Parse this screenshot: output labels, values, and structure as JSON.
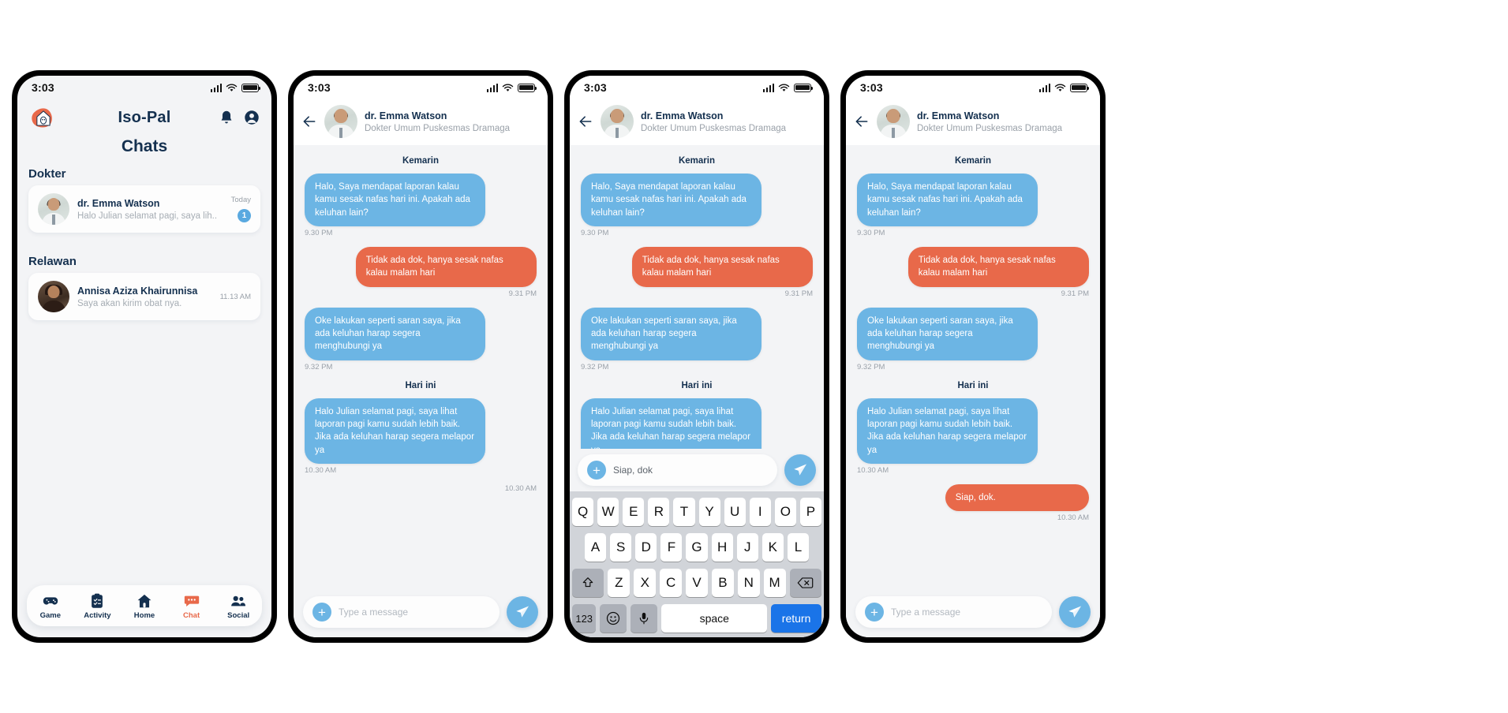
{
  "status_bar": {
    "time": "3:03",
    "signal_icon": "cellular-signal-icon",
    "wifi_icon": "wifi-icon",
    "battery_icon": "battery-full-icon"
  },
  "colors": {
    "brand_navy": "#14304f",
    "accent_orange": "#e8694a",
    "accent_blue": "#6cb5e4",
    "bg": "#f3f4f6",
    "card": "#fdfdfd"
  },
  "panel1": {
    "app_title": "Iso-Pal",
    "logo_name": "iso-pal-house-logo",
    "bell_icon": "notification-bell-icon",
    "profile_icon": "user-account-icon",
    "page_title": "Chats",
    "sections": [
      {
        "label": "Dokter",
        "items": [
          {
            "name": "dr. Emma Watson",
            "preview": "Halo Julian selamat pagi, saya lih..",
            "time": "Today",
            "badge": "1"
          }
        ]
      },
      {
        "label": "Relawan",
        "items": [
          {
            "name": "Annisa Aziza Khairunnisa",
            "preview": "Saya akan kirim obat nya.",
            "time": "11.13 AM",
            "badge": ""
          }
        ]
      }
    ],
    "bottom_nav": [
      {
        "label": "Game",
        "icon": "gamepad-icon",
        "active": false
      },
      {
        "label": "Activity",
        "icon": "clipboard-checklist-icon",
        "active": false
      },
      {
        "label": "Home",
        "icon": "home-icon",
        "active": false
      },
      {
        "label": "Chat",
        "icon": "chat-bubble-icon",
        "active": true
      },
      {
        "label": "Social",
        "icon": "people-group-icon",
        "active": false
      }
    ]
  },
  "conversation": {
    "back_icon": "back-arrow-icon",
    "avatar_name": "doctor-avatar",
    "name": "dr. Emma Watson",
    "subtitle": "Dokter Umum Puskesmas Dramaga",
    "day_separator_1": "Kemarin",
    "day_separator_2": "Hari ini",
    "messages": [
      {
        "side": "them",
        "text": "Halo, Saya mendapat laporan kalau kamu sesak nafas hari ini. Apakah ada keluhan lain?",
        "time": "9.30 PM"
      },
      {
        "side": "me",
        "text": "Tidak ada dok, hanya sesak nafas kalau malam hari",
        "time": "9.31 PM"
      },
      {
        "side": "them",
        "text": "Oke lakukan seperti saran saya, jika ada keluhan harap segera menghubungi ya",
        "time": "9.32 PM"
      }
    ],
    "messages_today": [
      {
        "side": "them",
        "text": "Halo Julian selamat pagi, saya lihat laporan pagi kamu sudah lebih baik. Jika ada keluhan harap segera melapor ya",
        "time": "10.30 AM"
      }
    ],
    "reply_sent": {
      "side": "me",
      "text": "Siap, dok.",
      "time": "10.30 AM"
    },
    "trailing_stamp": "10.30 AM",
    "composer": {
      "plus_icon": "plus-icon",
      "placeholder": "Type a message",
      "typed_value": "Siap, dok",
      "send_icon": "send-paper-plane-icon"
    }
  },
  "keyboard": {
    "row1": [
      "Q",
      "W",
      "E",
      "R",
      "T",
      "Y",
      "U",
      "I",
      "O",
      "P"
    ],
    "row2": [
      "A",
      "S",
      "D",
      "F",
      "G",
      "H",
      "J",
      "K",
      "L"
    ],
    "row3": [
      "Z",
      "X",
      "C",
      "V",
      "B",
      "N",
      "M"
    ],
    "shift_icon": "shift-arrow-icon",
    "backspace_icon": "backspace-delete-icon",
    "numeric_key": "123",
    "emoji_icon": "emoji-smiley-icon",
    "mic_icon": "microphone-icon",
    "space_key": "space",
    "return_key": "return"
  }
}
